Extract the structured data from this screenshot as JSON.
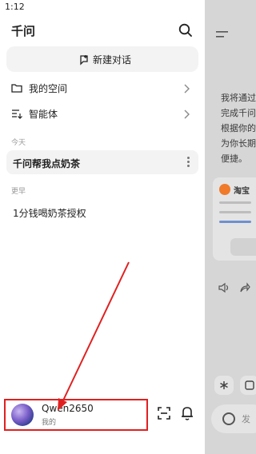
{
  "status_bar": {
    "time": "1:12"
  },
  "drawer": {
    "title": "千问",
    "new_chat_label": "新建对话",
    "nav": [
      {
        "label": "我的空间",
        "icon": "folder-icon"
      },
      {
        "label": "智能体",
        "icon": "agent-list-icon"
      }
    ],
    "sections": [
      {
        "label": "今天",
        "items": [
          "千问帮我点奶茶"
        ]
      },
      {
        "label": "更早",
        "items": [
          "1分钱喝奶茶授权"
        ]
      }
    ],
    "profile": {
      "name": "Qwen2650",
      "subtitle": "我的"
    }
  },
  "background_view": {
    "text_lines": [
      "我将通过",
      "完成千问",
      "根据你的",
      "为你长期",
      "便捷。"
    ],
    "card_title": "淘宝",
    "input_placeholder": "发"
  },
  "colors": {
    "annotation": "#e02020",
    "drawer_bg": "#ffffff",
    "overlay": "#d6d6d6"
  }
}
